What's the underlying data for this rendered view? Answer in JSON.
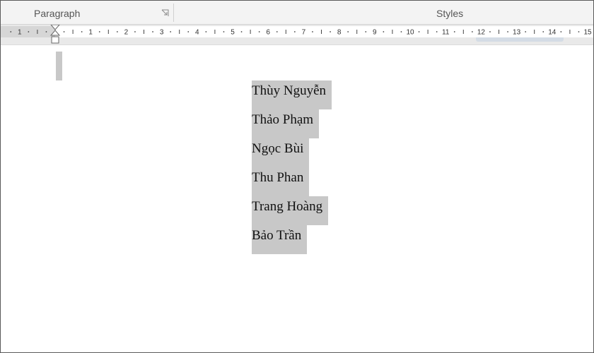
{
  "ribbon": {
    "groups": [
      {
        "label": "Paragraph"
      },
      {
        "label": "Styles"
      }
    ],
    "launcher_icon": "dialog-launcher-icon"
  },
  "ruler": {
    "left_labels": [
      "1"
    ],
    "labels": [
      "1",
      "2",
      "3",
      "4",
      "5",
      "6",
      "7",
      "8",
      "9",
      "10",
      "11",
      "12",
      "13",
      "14",
      "15"
    ]
  },
  "document": {
    "names": [
      "Thùy Nguyễn",
      "Thảo Phạm",
      "Ngọc Bùi",
      "Thu Phan",
      "Trang Hoàng",
      "Bảo Trần"
    ]
  },
  "colors": {
    "selection": "#c8c8c8",
    "ribbon_bg": "#f3f3f3",
    "ruler_bg": "#e9e9e9"
  }
}
